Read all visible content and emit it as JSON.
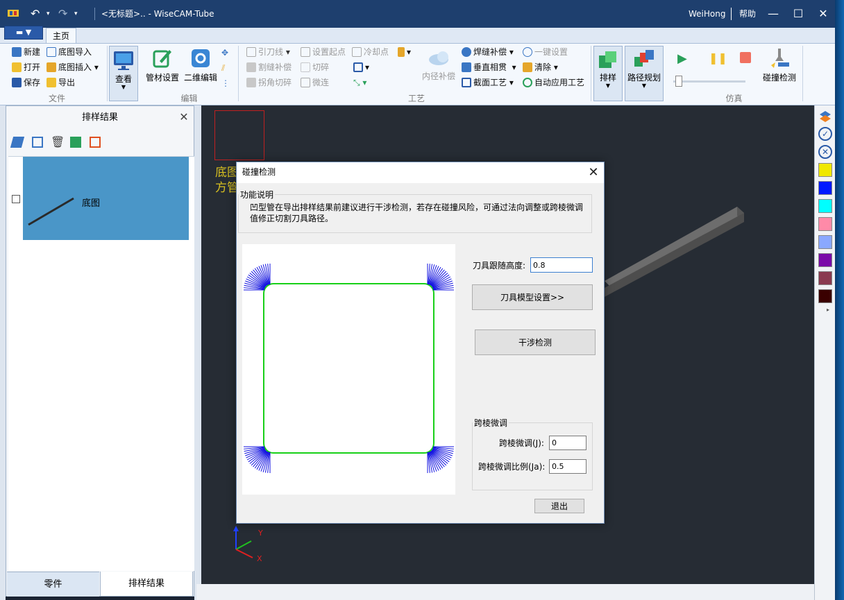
{
  "window": {
    "title": "<无标题>.. - WiseCAM-Tube",
    "user": "WeiHong",
    "help": "帮助"
  },
  "ribbon": {
    "file_tab": "▼",
    "home_tab": "主页",
    "groups": {
      "file": {
        "label": "文件",
        "new": "新建",
        "open": "打开",
        "save": "保存",
        "import_drawing": "底图导入",
        "insert_drawing": "底图插入",
        "export": "导出"
      },
      "view": {
        "label": "查看"
      },
      "edit": {
        "label": "编辑",
        "pipe_settings": "管材设置",
        "edit_2d": "二维编辑"
      },
      "process": {
        "label": "工艺",
        "lead_line": "引刀线",
        "set_start": "设置起点",
        "cooling_point": "冷却点",
        "kerf_comp": "割缝补偿",
        "cut_segments": "切碎",
        "corner_cut": "拐角切碎",
        "micro_joint": "微连",
        "inner_comp": "内径补偿",
        "weld_comp": "焊缝补偿",
        "vertical_through": "垂直相贯",
        "section_process": "截面工艺",
        "one_key": "一键设置",
        "clear": "清除",
        "auto_apply": "自动应用工艺"
      },
      "sim": {
        "label": "仿真",
        "nesting": "排样",
        "path_plan": "路径规划",
        "collision_check": "碰撞检测"
      }
    }
  },
  "left_panel": {
    "title": "排样结果",
    "items": [
      {
        "name": "底图",
        "checked": false
      }
    ],
    "tabs": [
      "零件",
      "排样结果"
    ]
  },
  "canvas": {
    "overlay_text_1": "底图",
    "overlay_text_2": "方管",
    "axis_y": "Y",
    "axis_x": "X"
  },
  "right_bar": {
    "colors": [
      "#f0e800",
      "#0018ff",
      "#00ffff",
      "#ff8aa8",
      "#8aa8ff",
      "#7a0aa8",
      "#8a3a50",
      "#3a0000"
    ]
  },
  "dialog": {
    "title": "碰撞检测",
    "function_legend": "功能说明",
    "function_text": "凹型管在导出排样结果前建议进行干涉检测，若存在碰撞风险，可通过法向调整或跨棱微调值修正切割刀具路径。",
    "tool_follow_height_label": "刀具跟随高度:",
    "tool_follow_height_value": "0.8",
    "tool_model_button": "刀具模型设置>>",
    "interference_button": "干涉检测",
    "ridge_legend": "跨棱微调",
    "ridge_fine_label": "跨棱微调(J):",
    "ridge_fine_value": "0",
    "ridge_ratio_label": "跨棱微调比例(Ja):",
    "ridge_ratio_value": "0.5",
    "exit_button": "退出"
  }
}
